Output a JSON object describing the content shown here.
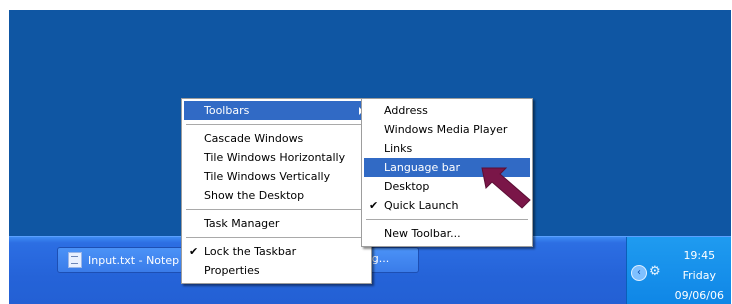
{
  "taskbar": {
    "task_button_label": "Input.txt - Notep",
    "task_button_right_text": "ag...",
    "clock": {
      "time": "19:45",
      "day": "Friday",
      "date": "09/06/06"
    }
  },
  "context_menu": {
    "items": [
      {
        "label": "Toolbars",
        "highlighted": true,
        "submenu": true
      },
      {
        "label": "Cascade Windows"
      },
      {
        "label": "Tile Windows Horizontally"
      },
      {
        "label": "Tile Windows Vertically"
      },
      {
        "label": "Show the Desktop"
      },
      {
        "label": "Task Manager"
      },
      {
        "label": "Lock the Taskbar",
        "checked": true
      },
      {
        "label": "Properties"
      }
    ]
  },
  "toolbars_submenu": {
    "items": [
      {
        "label": "Address"
      },
      {
        "label": "Windows Media Player"
      },
      {
        "label": "Links"
      },
      {
        "label": "Language bar",
        "highlighted": true
      },
      {
        "label": "Desktop"
      },
      {
        "label": "Quick Launch",
        "checked": true
      },
      {
        "label": "New Toolbar..."
      }
    ]
  },
  "icons": {
    "checkmark": "check-icon",
    "submenu_arrow": "chevron-right-icon",
    "tray_chevron": "chevron-left-icon",
    "annotation_arrow": "pointer-arrow-icon"
  },
  "colors": {
    "desktop": "#0f56a3",
    "highlight": "#316ac5",
    "annotation_arrow": "#7a1648"
  }
}
